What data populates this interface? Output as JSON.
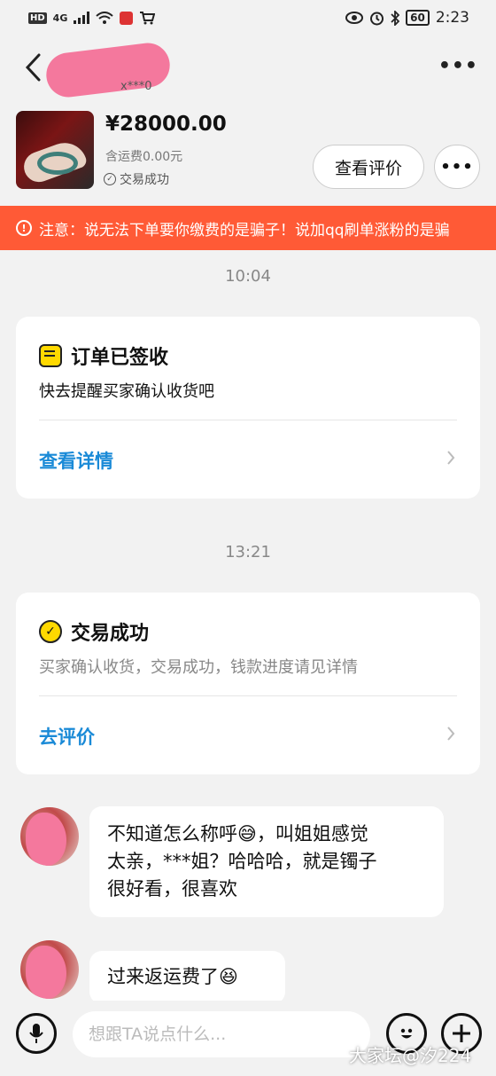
{
  "status_bar": {
    "network_badge": "HD",
    "network_type": "4G",
    "battery": "60",
    "time": "2:23"
  },
  "header": {
    "contact_id": "x***0",
    "back_icon": "chevron-left-icon",
    "more_icon": "more-dots-icon"
  },
  "product": {
    "price": "¥28000.00",
    "shipping": "含运费0.00元",
    "status": "交易成功",
    "review_button": "查看评价",
    "more_icon": "more-dots-icon"
  },
  "notice": {
    "text": "注意：说无法下单要你缴费的是骗子！说加qq刷单涨粉的是骗",
    "icon": "alert-circle-icon"
  },
  "messages": {
    "time1": "10:04",
    "card1": {
      "title": "订单已签收",
      "desc": "快去提醒买家确认收货吧",
      "link": "查看详情",
      "icon": "yellow-document-icon"
    },
    "time2": "13:21",
    "card2": {
      "title": "交易成功",
      "desc": "买家确认收货，交易成功，钱款进度请见详情",
      "link": "去评价",
      "icon": "yellow-check-icon"
    },
    "msg1": {
      "line1": "不知道怎么称呼😅，叫姐姐感觉",
      "line2": "太亲，***姐？哈哈哈，就是镯子",
      "line3": "很好看，很喜欢"
    },
    "msg2": {
      "text": "过来返运费了😆"
    }
  },
  "input_bar": {
    "placeholder": "想跟TA说点什么...",
    "voice_icon": "microphone-icon",
    "emoji_icon": "smiley-icon",
    "plus_icon": "plus-icon"
  },
  "watermark": "大家坛@汐224",
  "colors": {
    "notice_bg": "#ff5a36",
    "link_blue": "#1a8ad7",
    "accent_yellow": "#ffd900",
    "page_bg": "#f2f2f2"
  }
}
